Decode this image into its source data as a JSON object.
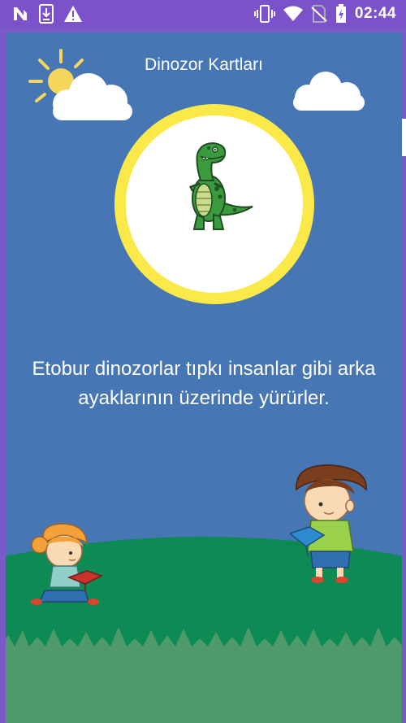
{
  "status_bar": {
    "time": "02:44",
    "left_icons": [
      "n-notification-icon",
      "download-notification-icon",
      "warning-icon"
    ],
    "right_icons": [
      "vibrate-icon",
      "wifi-icon",
      "no-sim-icon",
      "battery-charging-icon"
    ]
  },
  "page": {
    "title": "Dinozor Kartları",
    "fact_line1": "Etobur dinozorlar tıpkı insanlar gibi arka",
    "fact_line2": "ayaklarının üzerinde yürürler."
  },
  "colors": {
    "status_bar": "#7b52c9",
    "sky": "#4676b4",
    "sun_ring": "#fbe94a",
    "grass_dark": "#0e8a55",
    "grass_light": "#4e9a6b"
  }
}
